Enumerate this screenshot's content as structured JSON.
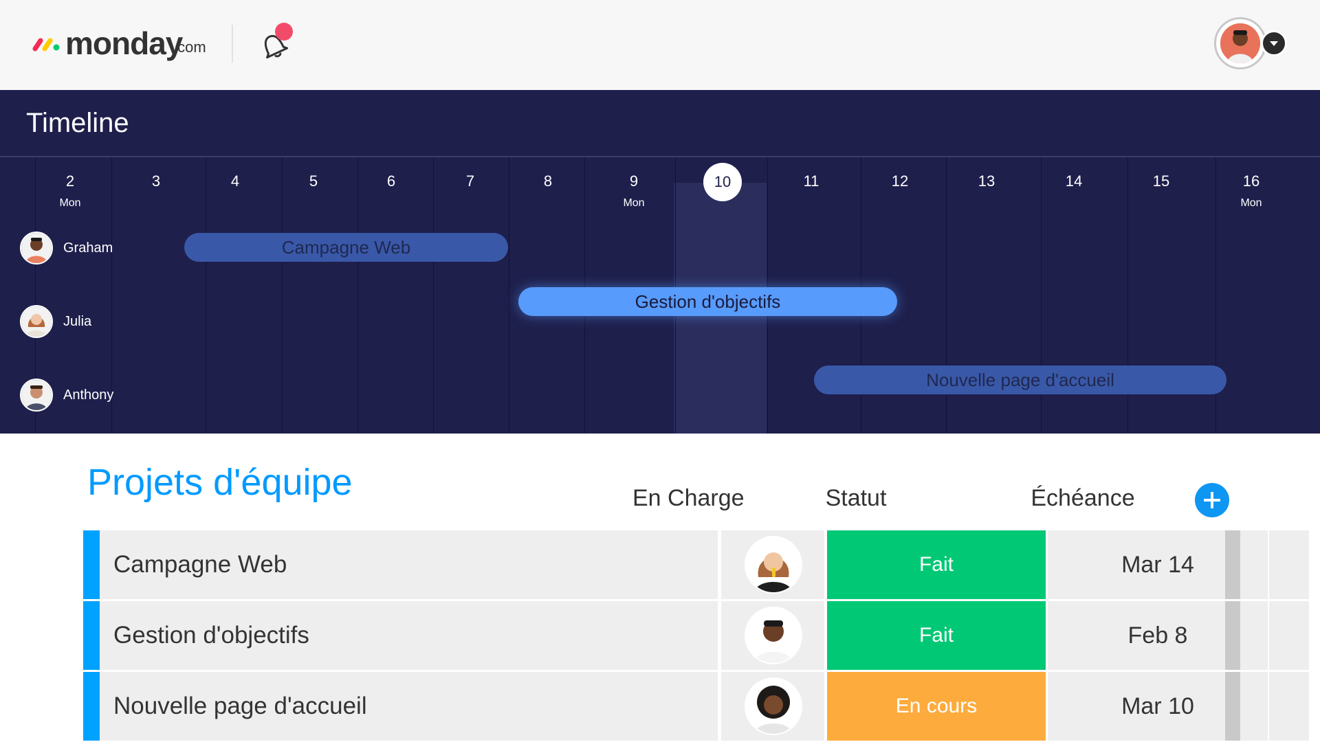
{
  "header": {
    "logo_word": "monday",
    "logo_suffix": ".com",
    "notification_icon": "bell-icon",
    "user_menu_icon": "chevron-down-icon"
  },
  "timeline": {
    "title": "Timeline",
    "days": [
      {
        "num": "2",
        "sub": "Mon"
      },
      {
        "num": "3",
        "sub": ""
      },
      {
        "num": "4",
        "sub": ""
      },
      {
        "num": "5",
        "sub": ""
      },
      {
        "num": "6",
        "sub": ""
      },
      {
        "num": "7",
        "sub": ""
      },
      {
        "num": "8",
        "sub": ""
      },
      {
        "num": "9",
        "sub": "Mon"
      },
      {
        "num": "10",
        "sub": ""
      },
      {
        "num": "11",
        "sub": ""
      },
      {
        "num": "12",
        "sub": ""
      },
      {
        "num": "13",
        "sub": ""
      },
      {
        "num": "14",
        "sub": ""
      },
      {
        "num": "15",
        "sub": ""
      },
      {
        "num": "16",
        "sub": "Mon"
      }
    ],
    "today": "10",
    "people": [
      "Graham",
      "Julia",
      "Anthony"
    ],
    "bars": [
      {
        "label": "Campagne Web",
        "person": "Graham"
      },
      {
        "label": "Gestion d'objectifs",
        "person": "Julia"
      },
      {
        "label": "Nouvelle page d'accueil",
        "person": "Anthony"
      }
    ]
  },
  "board": {
    "title": "Projets d'équipe",
    "columns": {
      "owner": "En Charge",
      "status": "Statut",
      "due": "Échéance"
    },
    "rows": [
      {
        "name": "Campagne Web",
        "status": "Fait",
        "status_color": "#00c875",
        "due": "Mar 14"
      },
      {
        "name": "Gestion d'objectifs",
        "status": "Fait",
        "status_color": "#00c875",
        "due": "Feb 8"
      },
      {
        "name": "Nouvelle page d'accueil",
        "status": "En cours",
        "status_color": "#fdab3d",
        "due": "Mar 10"
      }
    ]
  },
  "colors": {
    "timeline_bg": "#1e1f4b",
    "accent": "#00a2ff",
    "active_bar": "#579bfc",
    "dim_bar": "#3a58a8"
  }
}
